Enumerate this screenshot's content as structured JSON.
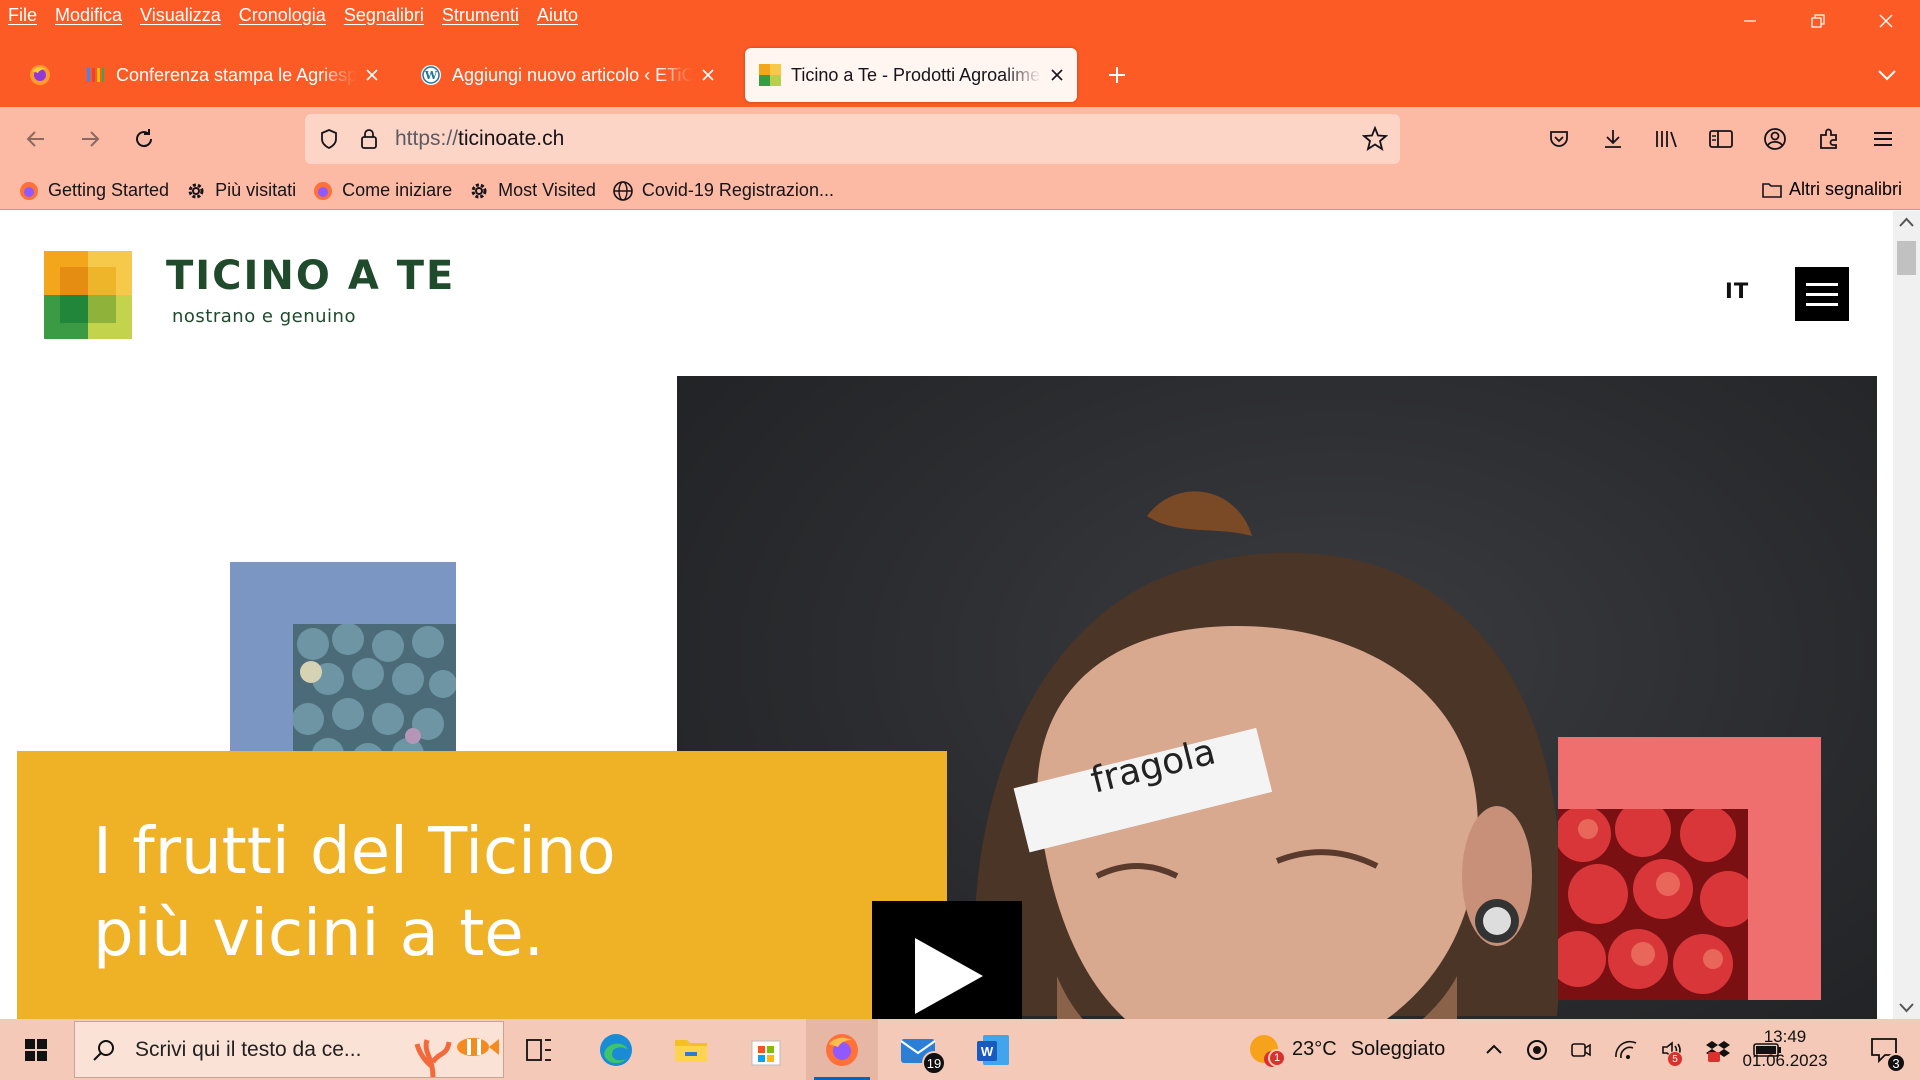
{
  "browser": {
    "menu": [
      "File",
      "Modifica",
      "Visualizza",
      "Cronologia",
      "Segnalibri",
      "Strumenti",
      "Aiuto"
    ],
    "tabs": [
      {
        "title": "Conferenza stampa le Agriesperienze",
        "active": false,
        "favicon": "google-workspace-icon"
      },
      {
        "title": "Aggiungi nuovo articolo ‹ ETiCiNo",
        "active": false,
        "favicon": "wordpress-icon"
      },
      {
        "title": "Ticino a Te - Prodotti Agroalimentari",
        "active": true,
        "favicon": "ticino-a-te-icon"
      }
    ],
    "url": {
      "scheme": "https://",
      "host": "ticinoate.ch"
    },
    "bookmarks": [
      {
        "label": "Getting Started",
        "icon": "firefox-icon"
      },
      {
        "label": "Più visitati",
        "icon": "gear-icon"
      },
      {
        "label": "Come iniziare",
        "icon": "firefox-icon"
      },
      {
        "label": "Most Visited",
        "icon": "gear-icon"
      },
      {
        "label": "Covid-19 Registrazion...",
        "icon": "globe-icon"
      }
    ],
    "other_bookmarks": "Altri segnalibri"
  },
  "page": {
    "brand_name": "TICINO A TE",
    "brand_tagline": "nostrano e genuino",
    "language": "IT",
    "headline_line1": "I frutti del Ticino",
    "headline_line2": "più vicini a te.",
    "forehead_label": "fragola"
  },
  "taskbar": {
    "search_placeholder": "Scrivi qui il testo da ce...",
    "mail_badge": "19",
    "weather_temp": "23°C",
    "weather_text": "Soleggiato",
    "weather_badge": "1",
    "time": "13:49",
    "date": "01.06.2023",
    "notifications": "3",
    "tray_badge": "5"
  },
  "colors": {
    "chrome": "#fd5b25",
    "navbar": "#fcb9a3",
    "brand_green": "#1f4a2b",
    "yellow_card": "#efb126",
    "blue_square": "#7c96c3",
    "pink_square": "#ef6f6f"
  }
}
